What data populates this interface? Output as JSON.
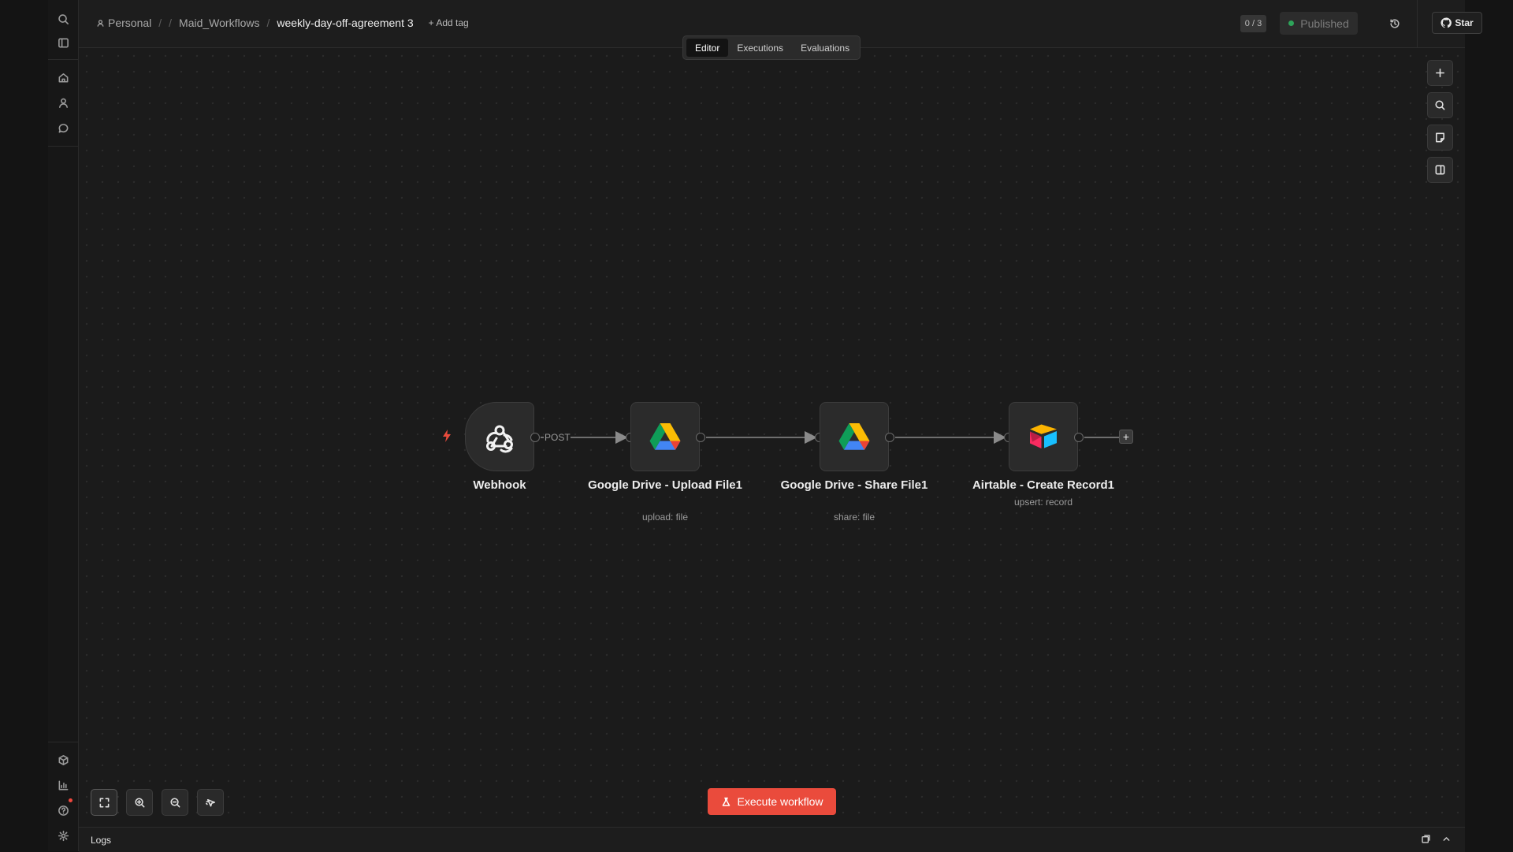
{
  "breadcrumb": {
    "project": "Personal",
    "folder": "Maid_Workflows",
    "workflow": "weekly-day-off-agreement 3",
    "add_tag": "+ Add tag"
  },
  "header": {
    "counter": "0 / 3",
    "status": "Published",
    "star_label": "Star"
  },
  "tabs": [
    "Editor",
    "Executions",
    "Evaluations"
  ],
  "active_tab": "Editor",
  "nodes": [
    {
      "name": "Webhook",
      "icon": "webhook-icon"
    },
    {
      "name": "Google Drive - Upload File1",
      "subtitle": "upload: file",
      "icon": "google-drive-icon"
    },
    {
      "name": "Google Drive - Share File1",
      "subtitle": "share: file",
      "icon": "google-drive-icon"
    },
    {
      "name": "Airtable - Create Record1",
      "subtitle": "upsert: record",
      "icon": "airtable-icon"
    }
  ],
  "connection_label": "POST",
  "execute_button": "Execute workflow",
  "logs_label": "Logs",
  "colors": {
    "accent": "#ea4b3c",
    "published_dot": "#2ea45a",
    "canvas": "#1b1b1b"
  }
}
